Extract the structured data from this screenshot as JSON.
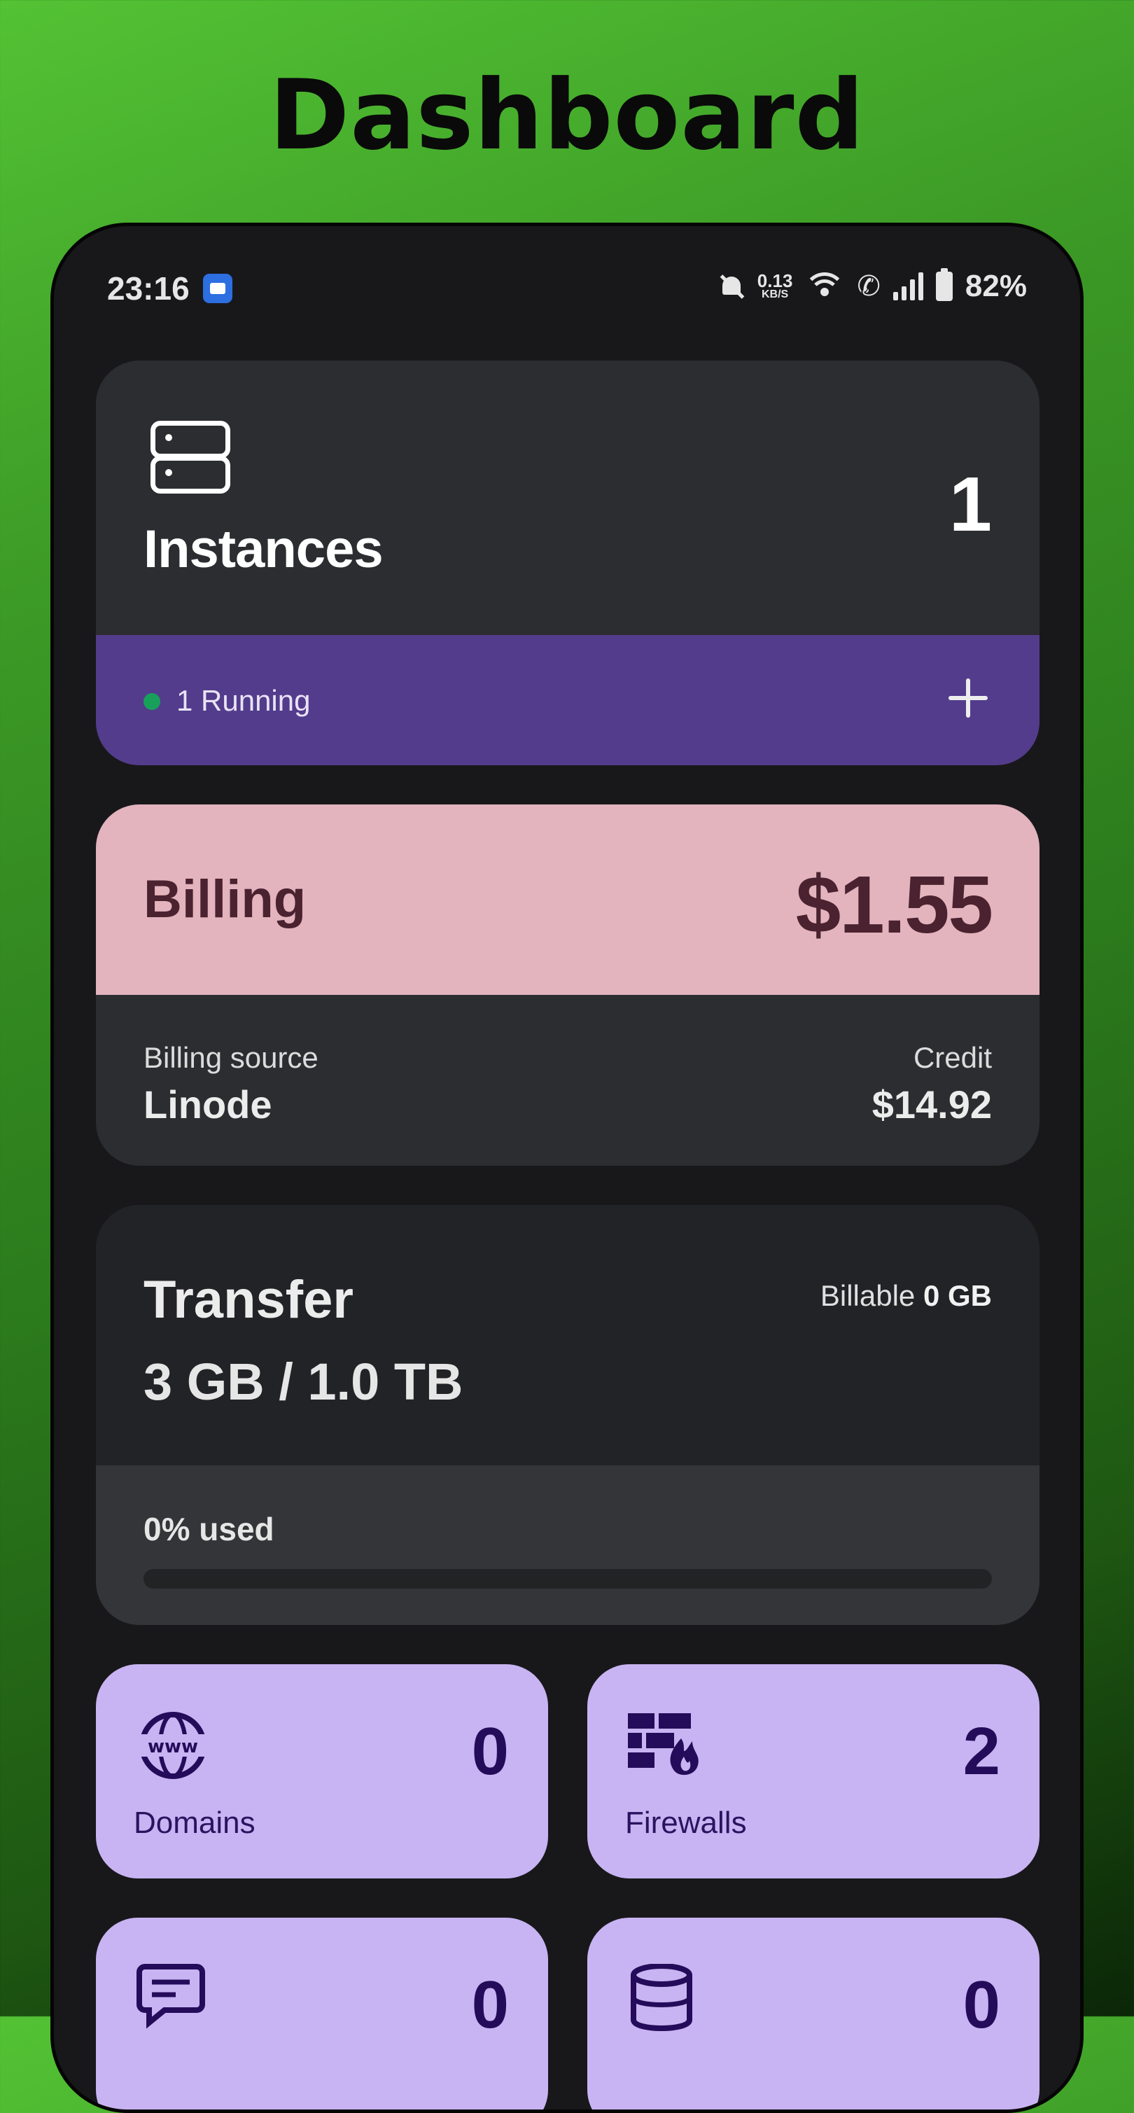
{
  "headline": "Dashboard",
  "status_bar": {
    "time": "23:16",
    "net_speed_value": "0.13",
    "net_speed_unit": "KB/S",
    "battery": "82%",
    "icons": [
      "files-icon",
      "bell-off-icon",
      "wifi-icon",
      "wifi-call-icon",
      "signal-icon",
      "battery-icon"
    ]
  },
  "instances": {
    "title": "Instances",
    "count": "1",
    "status": "1 Running",
    "status_color": "#18a05a",
    "accent_color": "#533c8c"
  },
  "billing": {
    "title": "Billing",
    "amount": "$1.55",
    "source_label": "Billing source",
    "source": "Linode",
    "credit_label": "Credit",
    "credit": "$14.92",
    "accent_color": "#e3b3be"
  },
  "transfer": {
    "title": "Transfer",
    "billable_label": "Billable",
    "billable_value": "0 GB",
    "usage": "3 GB / 1.0 TB",
    "used_label": "0% used",
    "used_fraction": 0
  },
  "tiles": [
    {
      "label": "Domains",
      "count": "0",
      "icon": "www-globe-icon"
    },
    {
      "label": "Firewalls",
      "count": "2",
      "icon": "firewall-icon"
    },
    {
      "label": "",
      "count": "0",
      "icon": "chat-icon"
    },
    {
      "label": "",
      "count": "0",
      "icon": "database-icon"
    }
  ],
  "tile_color": "#c8b4f2"
}
